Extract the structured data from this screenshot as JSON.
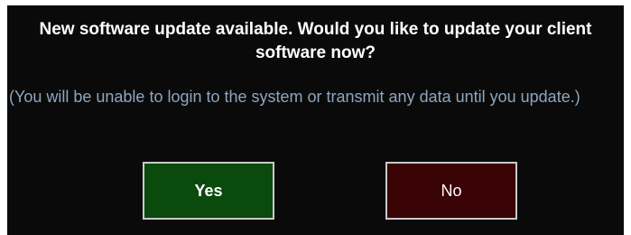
{
  "dialog": {
    "title": "New software update available. Would you like to update your client software now?",
    "message": "(You will be unable to login to the system or transmit any data until you update.)",
    "yes_label": "Yes",
    "no_label": "No"
  },
  "colors": {
    "background": "#0a0a0a",
    "title_text": "#ffffff",
    "message_text": "#8ea6be",
    "yes_button": "#0a4a0c",
    "no_button": "#3a0306",
    "button_border": "#c9c9c9"
  }
}
